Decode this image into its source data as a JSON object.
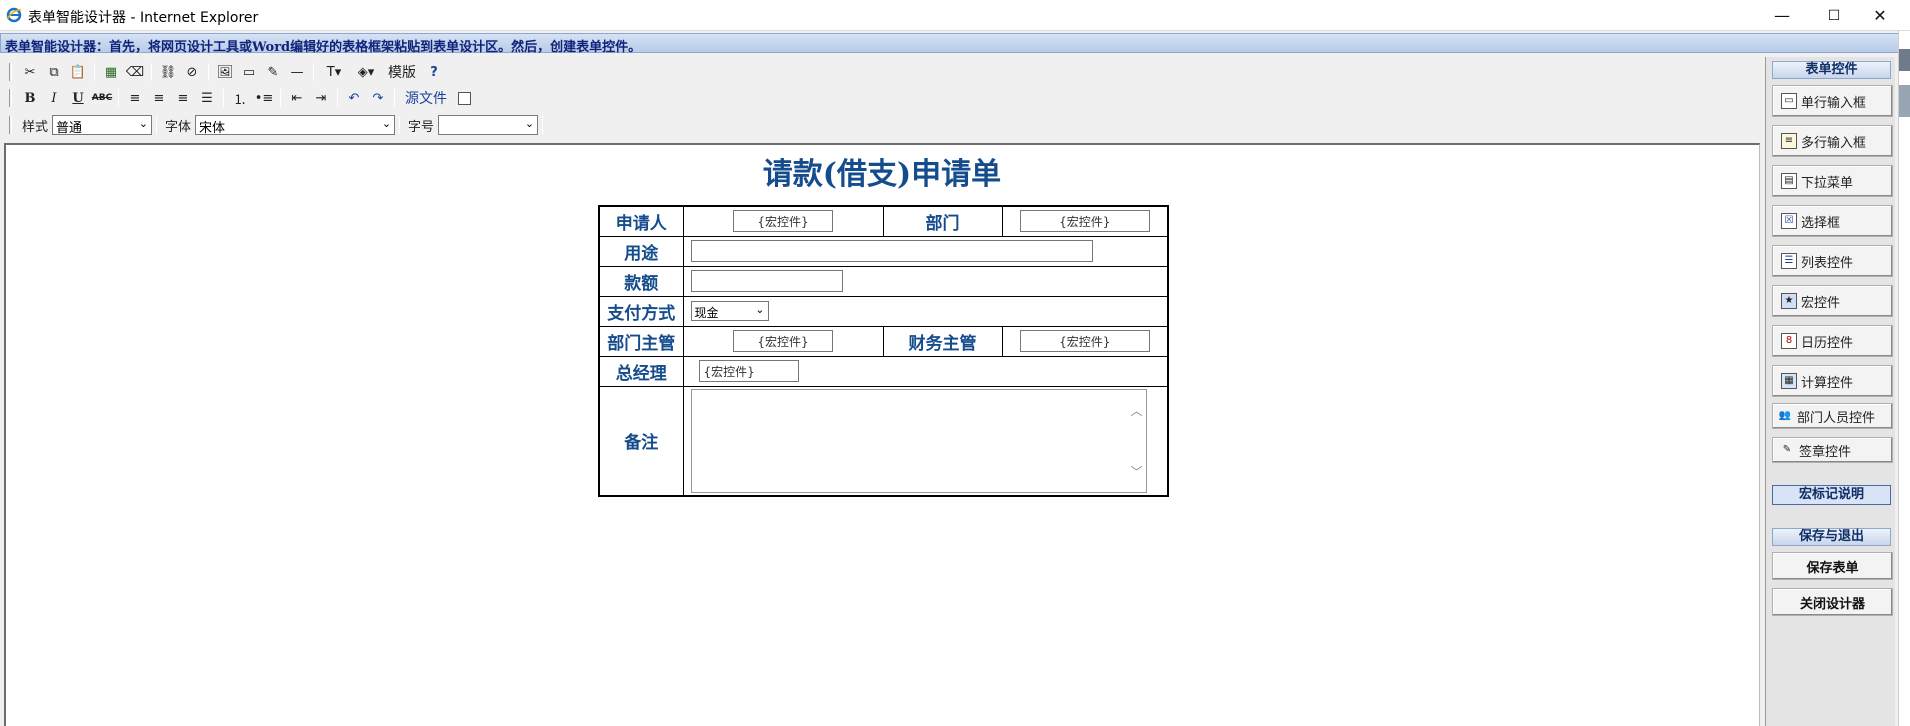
{
  "window": {
    "title": "表单智能设计器 - Internet Explorer",
    "minimize": "—",
    "maximize": "☐",
    "close": "✕"
  },
  "infobar": {
    "text": "表单智能设计器：首先，将网页设计工具或Word编辑好的表格框架粘贴到表单设计区。然后，创建表单控件。"
  },
  "toolbar1": {
    "template_label": "模版"
  },
  "toolbar2": {
    "source_label": "源文件"
  },
  "toolbar3": {
    "style_label": "样式",
    "style_value": "普通",
    "font_label": "字体",
    "font_value": "宋体",
    "size_label": "字号",
    "size_value": ""
  },
  "form": {
    "title": "请款(借支)申请单",
    "rows": {
      "applicant_label": "申请人",
      "applicant_value": "{宏控件}",
      "department_label": "部门",
      "department_value": "{宏控件}",
      "purpose_label": "用途",
      "amount_label": "款额",
      "payment_label": "支付方式",
      "payment_value": "现金",
      "dept_manager_label": "部门主管",
      "dept_manager_value": "{宏控件}",
      "finance_manager_label": "财务主管",
      "finance_manager_value": "{宏控件}",
      "gm_label": "总经理",
      "gm_value": "{宏控件}",
      "remark_label": "备注"
    }
  },
  "panel": {
    "controls_header": "表单控件",
    "controls": [
      {
        "label": "单行输入框",
        "icon": "single-line-input-icon"
      },
      {
        "label": "多行输入框",
        "icon": "multi-line-input-icon"
      },
      {
        "label": "下拉菜单",
        "icon": "dropdown-icon"
      },
      {
        "label": "选择框",
        "icon": "checkbox-icon"
      },
      {
        "label": "列表控件",
        "icon": "list-icon"
      },
      {
        "label": "宏控件",
        "icon": "macro-icon"
      },
      {
        "label": "日历控件",
        "icon": "calendar-icon"
      },
      {
        "label": "计算控件",
        "icon": "calculator-icon"
      },
      {
        "label": "部门人员控件",
        "icon": "people-icon"
      },
      {
        "label": "签章控件",
        "icon": "signature-icon"
      }
    ],
    "macro_help": "宏标记说明",
    "save_header": "保存与退出",
    "save_button": "保存表单",
    "close_button": "关闭设计器"
  }
}
